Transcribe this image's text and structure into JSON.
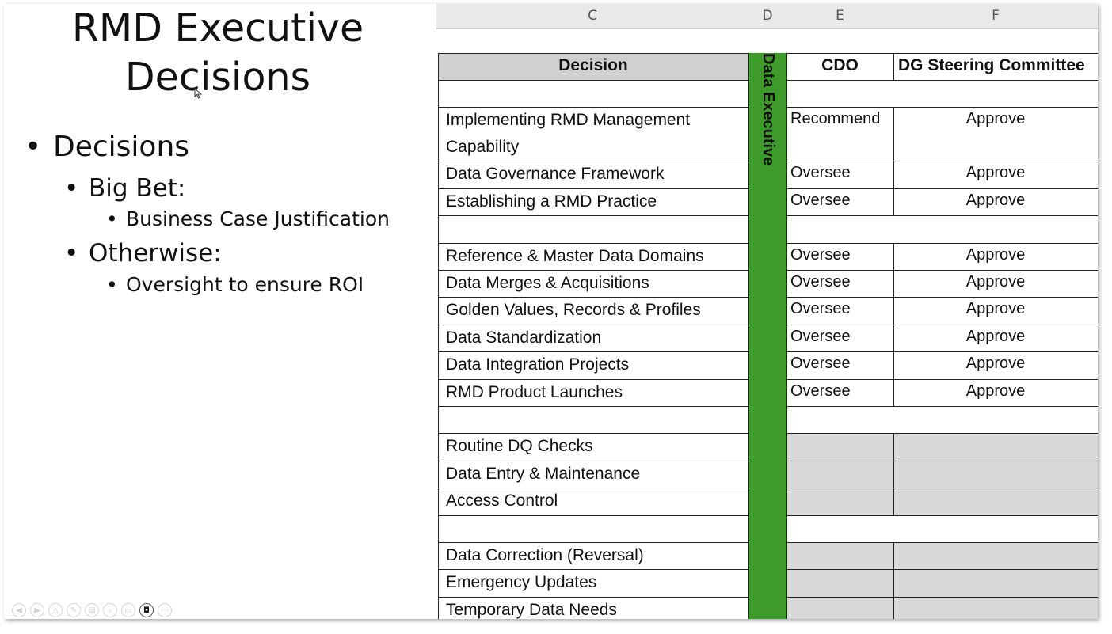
{
  "slide": {
    "title_line1": "RMD Executive",
    "title_line2": "Decisions",
    "bullets": [
      {
        "level": 1,
        "text": "Decisions"
      },
      {
        "level": 2,
        "text": "Big Bet:"
      },
      {
        "level": 3,
        "text": "Business Case Justification"
      },
      {
        "level": 2,
        "text": "Otherwise:"
      },
      {
        "level": 3,
        "text": "Oversight to ensure ROI"
      }
    ]
  },
  "sheet": {
    "column_headers": [
      "C",
      "D",
      "E",
      "F"
    ],
    "table_header": {
      "decision": "Decision",
      "cdo": "CDO",
      "dg": "DG Steering Committee"
    },
    "data_executive_label": "Data Executive",
    "rows": [
      {
        "decision": "",
        "cdo": "",
        "dg": "",
        "blank": true
      },
      {
        "decision": "Implementing RMD Management Capability",
        "cdo": "Recommend",
        "dg": "Approve",
        "tall": true
      },
      {
        "decision": "Data Governance Framework",
        "cdo": "Oversee",
        "dg": "Approve"
      },
      {
        "decision": "Establishing a RMD Practice",
        "cdo": "Oversee",
        "dg": "Approve"
      },
      {
        "decision": "",
        "cdo": "",
        "dg": "",
        "blank": true
      },
      {
        "decision": "Reference & Master Data Domains",
        "cdo": "Oversee",
        "dg": "Approve"
      },
      {
        "decision": "Data Merges & Acquisitions",
        "cdo": "Oversee",
        "dg": "Approve"
      },
      {
        "decision": "Golden Values, Records & Profiles",
        "cdo": "Oversee",
        "dg": "Approve"
      },
      {
        "decision": "Data Standardization",
        "cdo": "Oversee",
        "dg": "Approve"
      },
      {
        "decision": "Data Integration Projects",
        "cdo": "Oversee",
        "dg": "Approve"
      },
      {
        "decision": "RMD Product Launches",
        "cdo": "Oversee",
        "dg": "Approve"
      },
      {
        "decision": "",
        "cdo": "",
        "dg": "",
        "blank": true
      },
      {
        "decision": "Routine DQ Checks",
        "cdo": "",
        "dg": "",
        "shaded": true
      },
      {
        "decision": "Data Entry & Maintenance",
        "cdo": "",
        "dg": "",
        "shaded": true
      },
      {
        "decision": "Access Control",
        "cdo": "",
        "dg": "",
        "shaded": true
      },
      {
        "decision": "",
        "cdo": "",
        "dg": "",
        "blank": true
      },
      {
        "decision": "Data Correction (Reversal)",
        "cdo": "",
        "dg": "",
        "shaded": true
      },
      {
        "decision": "Emergency Updates",
        "cdo": "",
        "dg": "",
        "shaded": true
      },
      {
        "decision": "Temporary Data Needs",
        "cdo": "",
        "dg": "",
        "shaded": true
      }
    ]
  },
  "toolbar": {
    "icons": [
      "previous-icon",
      "next-icon",
      "pen-icon",
      "laser-icon",
      "slides-icon",
      "zoom-icon",
      "subtitles-icon",
      "camera-icon",
      "more-icon"
    ],
    "glyphs": [
      "◀",
      "▶",
      "△",
      "✎",
      "▤",
      "⌕",
      "▭",
      "◘",
      "⋯"
    ]
  },
  "colors": {
    "data_executive": "#3e9a2b",
    "header_fill": "#d0d0d0",
    "shaded_fill": "#d8d8d8"
  }
}
